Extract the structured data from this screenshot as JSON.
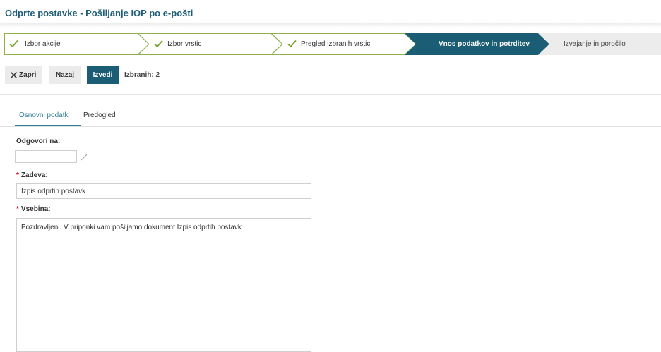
{
  "page": {
    "title": "Odprte postavke - Pošiljanje IOP po e-pošti"
  },
  "steps": [
    {
      "label": "Izbor akcije",
      "state": "done"
    },
    {
      "label": "Izbor vrstic",
      "state": "done"
    },
    {
      "label": "Pregled izbranih vrstic",
      "state": "done"
    },
    {
      "label": "Vnos podatkov in potrditev",
      "state": "active"
    },
    {
      "label": "Izvajanje in poročilo",
      "state": "todo"
    }
  ],
  "toolbar": {
    "close_label": "Zapri",
    "back_label": "Nazaj",
    "execute_label": "Izvedi",
    "selected_count": "Izbranih: 2"
  },
  "tabs": [
    {
      "label": "Osnovni podatki",
      "active": true
    },
    {
      "label": "Predogled",
      "active": false
    }
  ],
  "form": {
    "reply_to": {
      "label": "Odgovori na:",
      "value": ""
    },
    "subject": {
      "label": "Zadeva:",
      "required_mark": "*",
      "value": "Izpis odprtih postavk"
    },
    "body": {
      "label": "Vsebina:",
      "required_mark": "*",
      "value": "Pozdravljeni. V priponki vam pošiljamo dokument Izpis odprtih postavk."
    }
  },
  "colors": {
    "accent": "#1b5d75",
    "link": "#2f7d99",
    "check": "#7aa22e",
    "required": "#d0021b"
  },
  "icons": {
    "step_done": "check-icon",
    "close": "close-icon",
    "edit": "pencil-icon"
  }
}
